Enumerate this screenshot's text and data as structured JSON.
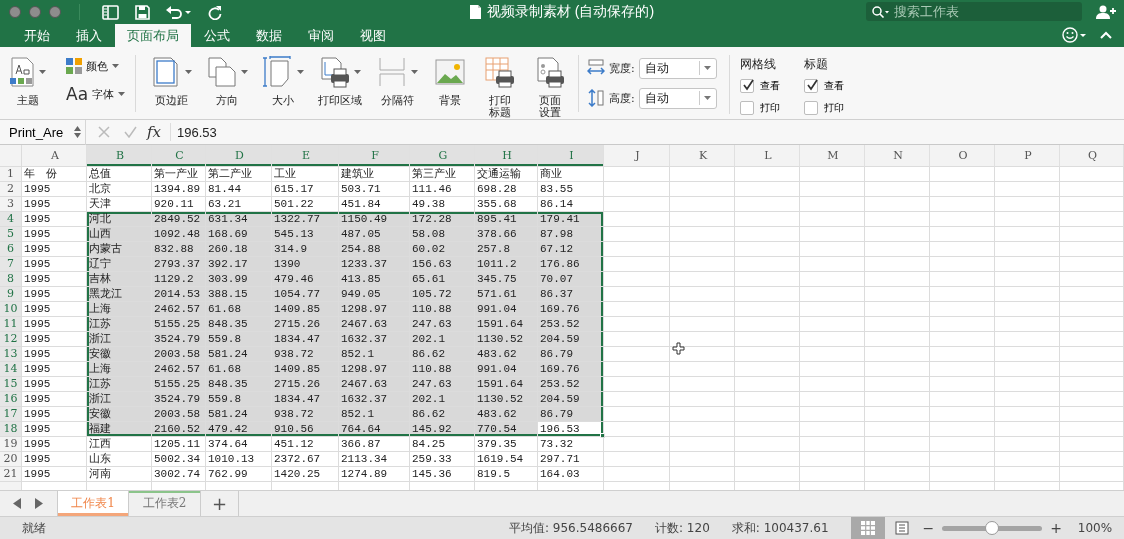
{
  "window": {
    "title": "视频录制素材 (自动保存的)",
    "search": {
      "placeholder": "搜索工作表"
    }
  },
  "ribbon_tabs": [
    {
      "label": "开始",
      "selected": false
    },
    {
      "label": "插入",
      "selected": false
    },
    {
      "label": "页面布局",
      "selected": true
    },
    {
      "label": "公式",
      "selected": false
    },
    {
      "label": "数据",
      "selected": false
    },
    {
      "label": "审阅",
      "selected": false
    },
    {
      "label": "视图",
      "selected": false
    }
  ],
  "ribbon": {
    "theme": {
      "label": "主题",
      "dropdown": true
    },
    "theme_options": [
      {
        "label": "颜色",
        "dropdown": true
      },
      {
        "label": "字体",
        "dropdown": true,
        "icon_text": "Aa"
      }
    ],
    "page_setup": [
      {
        "label": "页边距",
        "dropdown": true
      },
      {
        "label": "方向",
        "dropdown": true
      },
      {
        "label": "大小",
        "dropdown": true
      },
      {
        "label": "打印区域",
        "dropdown": true
      },
      {
        "label": "分隔符",
        "dropdown": true
      },
      {
        "label": "背景",
        "dropdown": false
      },
      {
        "label": "打印标题",
        "dropdown": false
      },
      {
        "label": "页面设置",
        "dropdown": false
      }
    ],
    "scale": [
      {
        "label": "宽度:",
        "value": "自动"
      },
      {
        "label": "高度:",
        "value": "自动"
      }
    ],
    "sheet_options": [
      {
        "title": "网格线",
        "options": [
          {
            "label": "查看",
            "checked": true
          },
          {
            "label": "打印",
            "checked": false
          }
        ]
      },
      {
        "title": "标题",
        "options": [
          {
            "label": "查看",
            "checked": true
          },
          {
            "label": "打印",
            "checked": false
          }
        ]
      }
    ]
  },
  "formula_bar": {
    "name_box": "Print_Are",
    "function_label": "fx",
    "value": "196.53"
  },
  "grid": {
    "columns": [
      {
        "label": "A",
        "selected": false
      },
      {
        "label": "B",
        "selected": true
      },
      {
        "label": "C",
        "selected": true
      },
      {
        "label": "D",
        "selected": true
      },
      {
        "label": "E",
        "selected": true
      },
      {
        "label": "F",
        "selected": true
      },
      {
        "label": "G",
        "selected": true
      },
      {
        "label": "H",
        "selected": true
      },
      {
        "label": "I",
        "selected": true
      },
      {
        "label": "J",
        "selected": false
      },
      {
        "label": "K",
        "selected": false
      },
      {
        "label": "L",
        "selected": false
      },
      {
        "label": "M",
        "selected": false
      },
      {
        "label": "N",
        "selected": false
      },
      {
        "label": "O",
        "selected": false
      },
      {
        "label": "P",
        "selected": false
      },
      {
        "label": "Q",
        "selected": false
      }
    ],
    "rows": [
      {
        "number": "1",
        "selected": false,
        "active": false,
        "cells": [
          "年　份",
          "总值",
          "第一产业",
          "第二产业",
          "工业",
          "建筑业",
          "第三产业",
          "交通运输",
          "商业"
        ]
      },
      {
        "number": "2",
        "selected": false,
        "active": false,
        "cells": [
          "1995",
          "北京",
          "1394.89",
          "81.44",
          "615.17",
          "503.71",
          "111.46",
          "698.28",
          "83.55"
        ]
      },
      {
        "number": "3",
        "selected": false,
        "active": false,
        "cells": [
          "1995",
          "天津",
          "920.11",
          "63.21",
          "501.22",
          "451.84",
          "49.38",
          "355.68",
          "86.14"
        ]
      },
      {
        "number": "4",
        "selected": true,
        "active": false,
        "cells": [
          "1995",
          "河北",
          "2849.52",
          "631.34",
          "1322.77",
          "1150.49",
          "172.28",
          "895.41",
          "179.41"
        ]
      },
      {
        "number": "5",
        "selected": true,
        "active": false,
        "cells": [
          "1995",
          "山西",
          "1092.48",
          "168.69",
          "545.13",
          "487.05",
          "58.08",
          "378.66",
          "87.98"
        ]
      },
      {
        "number": "6",
        "selected": true,
        "active": false,
        "cells": [
          "1995",
          "内蒙古",
          "832.88",
          "260.18",
          "314.9",
          "254.88",
          "60.02",
          "257.8",
          "67.12"
        ]
      },
      {
        "number": "7",
        "selected": true,
        "active": false,
        "cells": [
          "1995",
          "辽宁",
          "2793.37",
          "392.17",
          "1390",
          "1233.37",
          "156.63",
          "1011.2",
          "176.86"
        ]
      },
      {
        "number": "8",
        "selected": true,
        "active": false,
        "cells": [
          "1995",
          "吉林",
          "1129.2",
          "303.99",
          "479.46",
          "413.85",
          "65.61",
          "345.75",
          "70.07"
        ]
      },
      {
        "number": "9",
        "selected": true,
        "active": false,
        "cells": [
          "1995",
          "黑龙江",
          "2014.53",
          "388.15",
          "1054.77",
          "949.05",
          "105.72",
          "571.61",
          "86.37"
        ]
      },
      {
        "number": "10",
        "selected": true,
        "active": false,
        "cells": [
          "1995",
          "上海",
          "2462.57",
          "61.68",
          "1409.85",
          "1298.97",
          "110.88",
          "991.04",
          "169.76"
        ]
      },
      {
        "number": "11",
        "selected": true,
        "active": false,
        "cells": [
          "1995",
          "江苏",
          "5155.25",
          "848.35",
          "2715.26",
          "2467.63",
          "247.63",
          "1591.64",
          "253.52"
        ]
      },
      {
        "number": "12",
        "selected": true,
        "active": false,
        "cells": [
          "1995",
          "浙江",
          "3524.79",
          "559.8",
          "1834.47",
          "1632.37",
          "202.1",
          "1130.52",
          "204.59"
        ]
      },
      {
        "number": "13",
        "selected": true,
        "active": false,
        "cells": [
          "1995",
          "安徽",
          "2003.58",
          "581.24",
          "938.72",
          "852.1",
          "86.62",
          "483.62",
          "86.79"
        ]
      },
      {
        "number": "14",
        "selected": true,
        "active": false,
        "cells": [
          "1995",
          "上海",
          "2462.57",
          "61.68",
          "1409.85",
          "1298.97",
          "110.88",
          "991.04",
          "169.76"
        ]
      },
      {
        "number": "15",
        "selected": true,
        "active": false,
        "cells": [
          "1995",
          "江苏",
          "5155.25",
          "848.35",
          "2715.26",
          "2467.63",
          "247.63",
          "1591.64",
          "253.52"
        ]
      },
      {
        "number": "16",
        "selected": true,
        "active": false,
        "cells": [
          "1995",
          "浙江",
          "3524.79",
          "559.8",
          "1834.47",
          "1632.37",
          "202.1",
          "1130.52",
          "204.59"
        ]
      },
      {
        "number": "17",
        "selected": true,
        "active": false,
        "cells": [
          "1995",
          "安徽",
          "2003.58",
          "581.24",
          "938.72",
          "852.1",
          "86.62",
          "483.62",
          "86.79"
        ]
      },
      {
        "number": "18",
        "selected": true,
        "active": true,
        "cells": [
          "1995",
          "福建",
          "2160.52",
          "479.42",
          "910.56",
          "764.64",
          "145.92",
          "770.54",
          "196.53"
        ]
      },
      {
        "number": "19",
        "selected": false,
        "active": false,
        "cells": [
          "1995",
          "江西",
          "1205.11",
          "374.64",
          "451.12",
          "366.87",
          "84.25",
          "379.35",
          "73.32"
        ]
      },
      {
        "number": "20",
        "selected": false,
        "active": false,
        "cells": [
          "1995",
          "山东",
          "5002.34",
          "1010.13",
          "2372.67",
          "2113.34",
          "259.33",
          "1619.54",
          "297.71"
        ]
      },
      {
        "number": "21",
        "selected": false,
        "active": false,
        "cells": [
          "1995",
          "河南",
          "3002.74",
          "762.99",
          "1420.25",
          "1274.89",
          "145.36",
          "819.5",
          "164.03"
        ]
      }
    ]
  },
  "sheet_tabs": {
    "tabs": [
      {
        "label": "工作表1",
        "selected": true
      },
      {
        "label": "工作表2",
        "selected": false
      }
    ],
    "add_label": "+"
  },
  "status_bar": {
    "status": "就绪",
    "stats": [
      "平均值: 956.5486667",
      "计数: 120",
      "求和: 100437.61"
    ],
    "views": [
      {
        "selected": true
      },
      {
        "selected": false
      }
    ],
    "zoom": {
      "minus_label": "−",
      "plus_label": "+",
      "level": 0.5,
      "value": "100%"
    }
  }
}
